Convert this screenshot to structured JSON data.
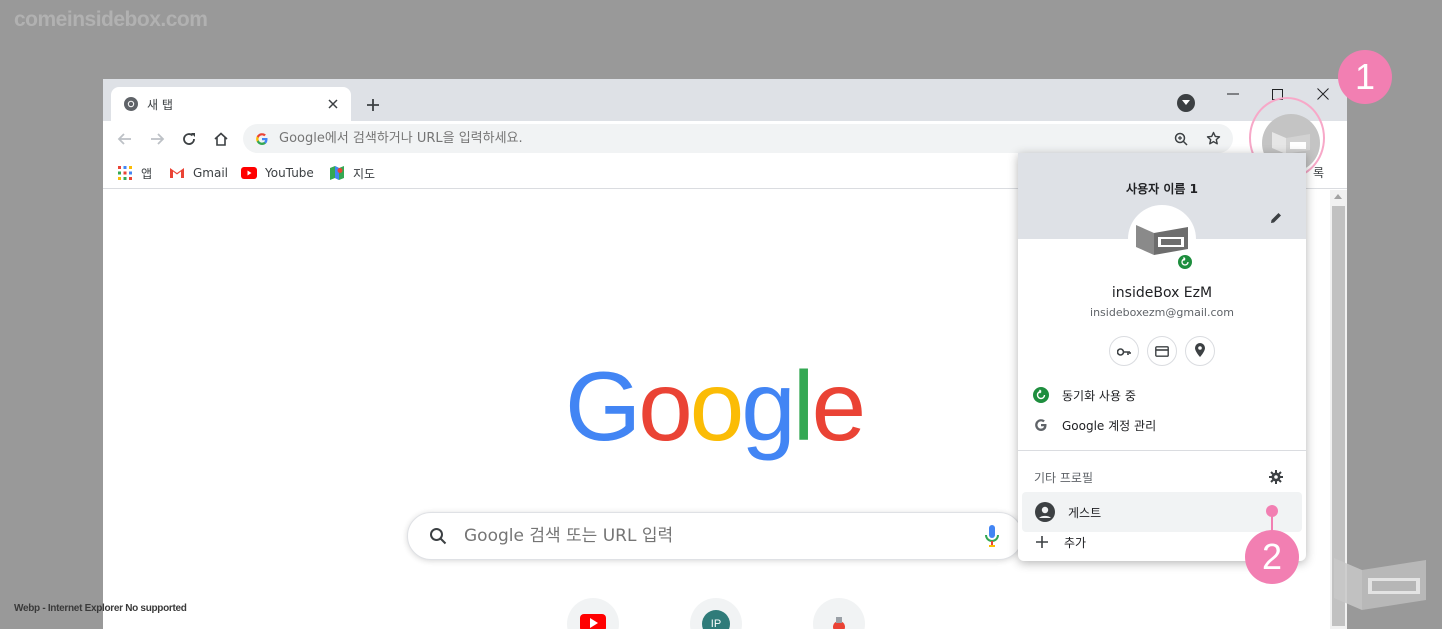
{
  "watermark": {
    "site": "comeinsidebox.com",
    "note": "Webp - Internet Explorer No supported"
  },
  "colors": {
    "accent_pink": "#f27fb2",
    "sync_green": "#1e8e3e",
    "chrome_gray": "#dee1e6"
  },
  "tab": {
    "title": "새 탭",
    "favicon": "chrome-icon"
  },
  "toolbar": {
    "omnibox_placeholder": "Google에서 검색하거나 URL을 입력하세요."
  },
  "bookmarks": {
    "items": [
      {
        "label": "앱",
        "icon": "apps-grid-icon"
      },
      {
        "label": "Gmail",
        "icon": "gmail-icon"
      },
      {
        "label": "YouTube",
        "icon": "youtube-icon"
      },
      {
        "label": "지도",
        "icon": "maps-icon"
      }
    ],
    "overflow_label": "록"
  },
  "new_tab_page": {
    "logo_text": "Google",
    "search_placeholder": "Google 검색 또는 URL 입력",
    "shortcuts": [
      "youtube-icon",
      "ip-avatar-icon",
      "shortcut-icon"
    ],
    "ip_letters": "IP"
  },
  "profile_menu": {
    "username": "사용자 이름 1",
    "display_name": "insideBox EzM",
    "email": "insideboxezm@gmail.com",
    "quick_icons": [
      "key-icon",
      "credit-card-icon",
      "location-pin-icon"
    ],
    "sync_label": "동기화 사용 중",
    "manage_label": "Google 계정 관리",
    "other_profiles_label": "기타 프로필",
    "guest_label": "게스트",
    "add_label": "추가"
  },
  "callouts": {
    "one": "1",
    "two": "2"
  }
}
